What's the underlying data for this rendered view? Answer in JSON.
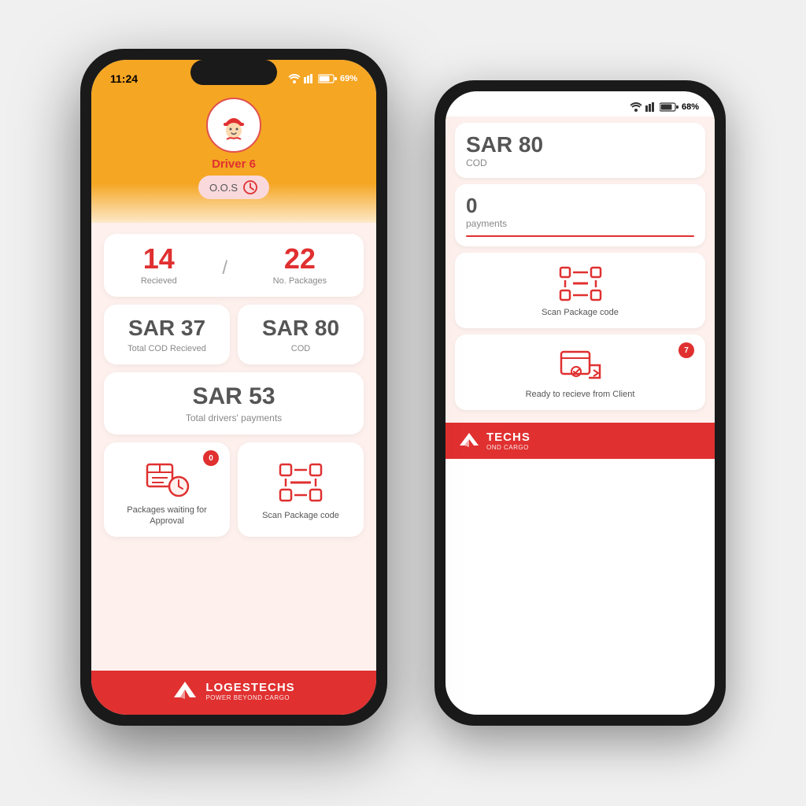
{
  "front_phone": {
    "status_bar": {
      "time": "11:24",
      "battery": "69%",
      "signal": "wifi+cellular"
    },
    "header": {
      "driver_name": "Driver 6",
      "status": "O.O.S"
    },
    "stats": {
      "received": "14",
      "received_label": "Recieved",
      "divider": "/",
      "packages": "22",
      "packages_label": "No. Packages",
      "sar_cod_received": "SAR 37",
      "sar_cod_received_label": "Total COD Recieved",
      "sar_cod": "SAR 80",
      "sar_cod_label": "COD",
      "total_payment": "SAR 53",
      "total_payment_label": "Total drivers' payments"
    },
    "actions": {
      "waiting_label": "Packages waiting for Approval",
      "waiting_badge": "0",
      "scan_label": "Scan Package code"
    },
    "footer": {
      "brand": "LOGESTECHS",
      "tagline": "POWER BEYOND CARGO"
    }
  },
  "back_phone": {
    "status_bar": {
      "battery": "68%"
    },
    "cards": {
      "sar_top": "SAR 80",
      "sar_top_label": "COD",
      "payments_label": "payments",
      "scan_label": "Scan Package code",
      "ready_label": "Ready to recieve from Client",
      "ready_badge": "7"
    },
    "footer": {
      "brand": "TECHS",
      "tagline": "OND CARGO"
    }
  }
}
